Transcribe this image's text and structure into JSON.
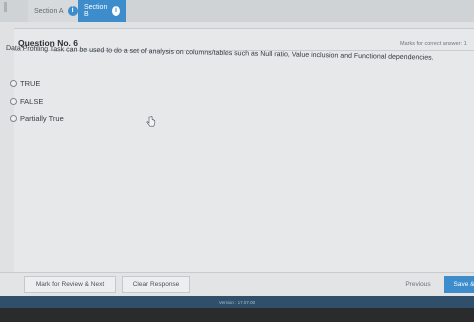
{
  "tabs": [
    {
      "label": "Section A",
      "info": "i"
    },
    {
      "label": "Section B",
      "info": "i"
    }
  ],
  "question": {
    "title": "Question No. 6",
    "marks": "Marks for correct answer: 1",
    "text": "Data Profiling Task can be used to do a set of analysis on columns/tables such as Null ratio, Value inclusion and Functional dependencies."
  },
  "options": [
    {
      "label": "TRUE"
    },
    {
      "label": "FALSE"
    },
    {
      "label": "Partially True"
    }
  ],
  "footer": {
    "review": "Mark for Review & Next",
    "clear": "Clear Response",
    "previous": "Previous",
    "save": "Save &"
  },
  "version": "Version : 17.07.00",
  "colors": {
    "accent": "#3d8ccc",
    "version_bar": "#2f4f6a"
  }
}
